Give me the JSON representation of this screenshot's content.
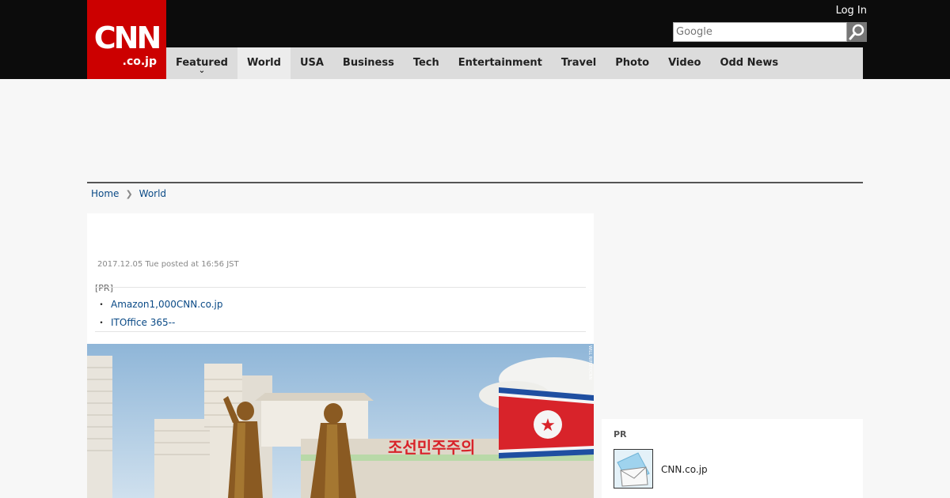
{
  "header": {
    "logo": {
      "wordmark": "CNN",
      "suffix": ".co.jp"
    },
    "login_label": "Log In",
    "search": {
      "placeholder": "Google",
      "value": ""
    }
  },
  "nav": {
    "items": [
      {
        "label": "Featured",
        "has_dropdown": true
      },
      {
        "label": "World",
        "active": true
      },
      {
        "label": "USA"
      },
      {
        "label": "Business"
      },
      {
        "label": "Tech"
      },
      {
        "label": "Entertainment"
      },
      {
        "label": "Travel"
      },
      {
        "label": "Photo"
      },
      {
        "label": "Video"
      },
      {
        "label": "Odd News"
      }
    ]
  },
  "breadcrumb": {
    "home": "Home",
    "section": "World"
  },
  "article": {
    "dateline": "2017.12.05 Tue posted at 16:56 JST",
    "pr_label": "[PR]",
    "pr_links": [
      "Amazon1,000CNN.co.jp",
      "ITOffice 365--"
    ],
    "photo": {
      "credit": "WILL RIPLEY/CNN",
      "sign_text": "조선민주주의"
    }
  },
  "sidebar": {
    "pr_title": "PR",
    "pr_item_caption": "CNN.co.jp"
  },
  "colors": {
    "brand_red": "#cc0000",
    "topbar": "#0c0c0c",
    "nav_bg": "#dcdcdc",
    "link": "#0a4a86"
  },
  "icons": [
    "search-icon",
    "chevron-down-icon",
    "chevron-right-icon"
  ]
}
